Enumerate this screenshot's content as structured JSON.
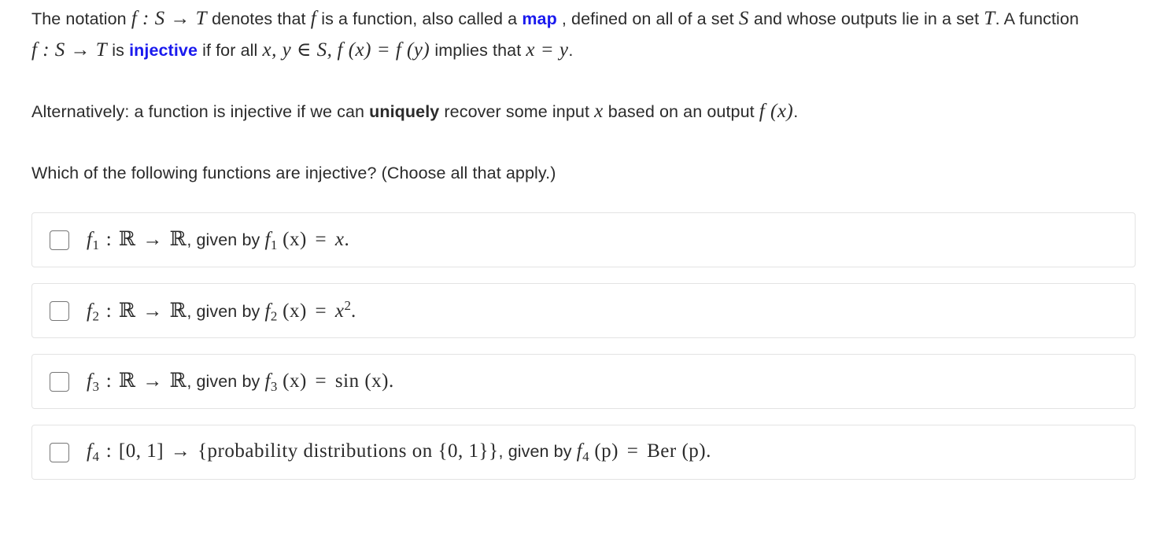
{
  "intro": {
    "t1": "The notation ",
    "m1": "f : S → T",
    "t2": " denotes that ",
    "m2": "f",
    "t3": " is a function, also called a ",
    "link_map": "map",
    "t4": " , defined on all of a set ",
    "m3": "S",
    "t5": " and whose outputs lie in a set ",
    "m4": "T",
    "t6": ". A function ",
    "m5": "f : S → T",
    "t7": " is ",
    "link_injective": "injective",
    "t8": " if for all ",
    "m6": "x, y ∈ S,",
    "m7": "f (x) = f (y)",
    "t9": " implies that ",
    "m8": "x = y",
    "t10": "."
  },
  "alternative": {
    "t1": "Alternatively: a function is injective if we can ",
    "bold": "uniquely",
    "t2": " recover some input ",
    "m1": "x",
    "t3": " based on an output ",
    "m2": "f (x)",
    "t4": "."
  },
  "question": {
    "prompt": "Which of the following functions are injective? (Choose all that apply.)"
  },
  "options": [
    {
      "id": "option-f1",
      "checked": false,
      "fn": "f",
      "index": "1",
      "domain": "ℝ",
      "arrow": "→",
      "codomain": "ℝ",
      "comma": ",",
      "given_by": "given by",
      "rule_lhs": "f",
      "rule_index": "1",
      "rule_arg": "(x)",
      "equals": "=",
      "rule_rhs": "x",
      "period": "."
    },
    {
      "id": "option-f2",
      "checked": false,
      "fn": "f",
      "index": "2",
      "domain": "ℝ",
      "arrow": "→",
      "codomain": "ℝ",
      "comma": ",",
      "given_by": "given by",
      "rule_lhs": "f",
      "rule_index": "2",
      "rule_arg": "(x)",
      "equals": "=",
      "rule_rhs": "x",
      "rule_exp": "2",
      "period": "."
    },
    {
      "id": "option-f3",
      "checked": false,
      "fn": "f",
      "index": "3",
      "domain": "ℝ",
      "arrow": "→",
      "codomain": "ℝ",
      "comma": ",",
      "given_by": "given by",
      "rule_lhs": "f",
      "rule_index": "3",
      "rule_arg": "(x)",
      "equals": "=",
      "rule_rhs": "sin (x)",
      "period": "."
    },
    {
      "id": "option-f4",
      "checked": false,
      "fn": "f",
      "index": "4",
      "domain": "[0, 1]",
      "arrow": "→",
      "codomain": "{probability distributions on {0, 1}}",
      "comma": ",",
      "given_by": "given by",
      "rule_lhs": "f",
      "rule_index": "4",
      "rule_arg": "(p)",
      "equals": "=",
      "rule_rhs": "Ber (p)",
      "period": "."
    }
  ],
  "colors": {
    "text": "#2b2b2b",
    "link": "#1a1aee",
    "card_border": "#e3e3e3",
    "checkbox_border": "#767676",
    "background": "#ffffff"
  }
}
